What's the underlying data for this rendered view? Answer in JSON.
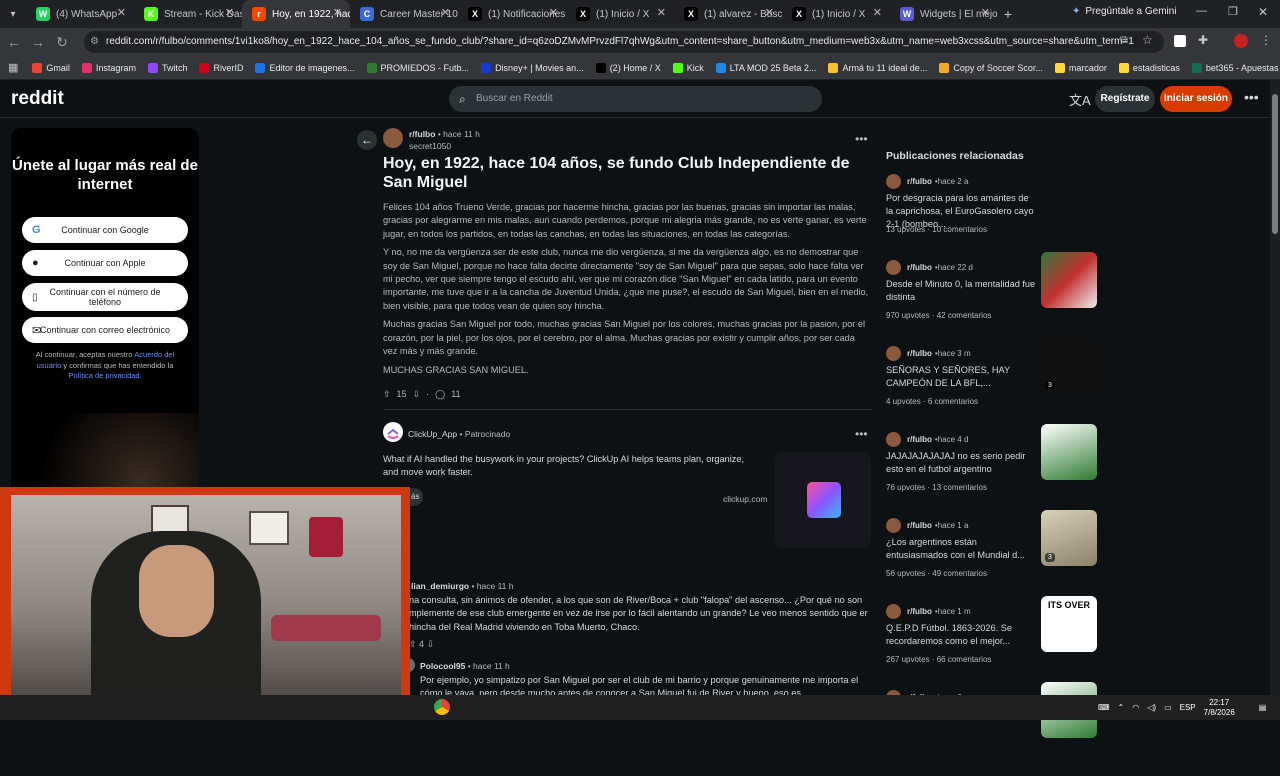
{
  "browser": {
    "tabs": [
      {
        "label": "(4) WhatsApp",
        "color": "#25d366",
        "glyph": "W"
      },
      {
        "label": "Stream - Kick Dash",
        "color": "#53fc18",
        "glyph": "K"
      },
      {
        "label": "Hoy, en 1922, hace",
        "color": "#ff4500",
        "glyph": "r"
      },
      {
        "label": "Career Master 10",
        "color": "#3b6ad6",
        "glyph": "C"
      },
      {
        "label": "(1) Notificaciones",
        "color": "#000000",
        "glyph": "X"
      },
      {
        "label": "(1) Inicio / X",
        "color": "#000000",
        "glyph": "X"
      },
      {
        "label": "(1) alvarez - Buscar",
        "color": "#000000",
        "glyph": "X"
      },
      {
        "label": "(1) Inicio / X",
        "color": "#000000",
        "glyph": "X"
      },
      {
        "label": "Widgets | El mejor",
        "color": "#5b5bd6",
        "glyph": "W"
      }
    ],
    "new_tab": "+",
    "gemini": "Pregúntale a Gemini",
    "url": "reddit.com/r/fulbo/comments/1vi1ko8/hoy_en_1922_hace_104_años_se_fundo_club/?share_id=q6zoDZMvMPrvzdFl7qhWg&utm_content=share_button&utm_medium=web3x&utm_name=web3xcss&utm_source=share&utm_term=1",
    "bookmarks": [
      {
        "label": "Gmail",
        "color": "#ea4335"
      },
      {
        "label": "Instagram",
        "color": "#e1306c"
      },
      {
        "label": "Twitch",
        "color": "#9146ff"
      },
      {
        "label": "RiverID",
        "color": "#d0021b"
      },
      {
        "label": "Editor de imagenes...",
        "color": "#1a73e8"
      },
      {
        "label": "PROMIEDOS - Futb...",
        "color": "#2e7d32"
      },
      {
        "label": "Disney+ | Movies an...",
        "color": "#113ccf"
      },
      {
        "label": "(2) Home / X",
        "color": "#000000"
      },
      {
        "label": "Kick",
        "color": "#53fc18"
      },
      {
        "label": "LTA MOD 25 Beta 2...",
        "color": "#1e88e5"
      },
      {
        "label": "Armá tu 11 ideal de...",
        "color": "#fbc02d"
      },
      {
        "label": "Copy of Soccer Scor...",
        "color": "#f9a825"
      },
      {
        "label": "marcador",
        "color": "#fdd835"
      },
      {
        "label": "estadisticas",
        "color": "#fdd835"
      },
      {
        "label": "bet365 - Apuestas d...",
        "color": "#126e51"
      }
    ]
  },
  "reddit": {
    "logo": "reddit",
    "search_placeholder": "Buscar en Reddit",
    "register": "Regístrate",
    "login": "Iniciar sesión"
  },
  "join": {
    "title": "Únete al lugar más real de internet",
    "google": "Continuar con Google",
    "apple": "Continuar con Apple",
    "phone": "Continuar con el número de teléfono",
    "email": "Continuar con correo electrónico",
    "terms_1": "Al continuar, aceptas nuestro",
    "terms_link1": "Acuerdo del usuario",
    "terms_2": "y confirmas que has entendido la",
    "terms_link2": "Política de privacidad."
  },
  "post": {
    "subreddit": "r/fulbo",
    "time": "hace 11 h",
    "author": "secret1050",
    "title": "Hoy, en 1922, hace 104 años, se fundo Club Independiente de San Miguel",
    "paragraphs": [
      "Felices 104 años Trueno Verde, gracias por hacerme hincha, gracias por las buenas, gracias sin importar las malas, gracias por alegrarme en mis malas, aun cuando perdemos, porque mi alegria más grande, no es verte ganar, es verte jugar, en todos los partidos, en todas las canchas, en todas las situaciones, en todas las categorías.",
      "Y no, no me da vergüenza ser de este club, nunca me dio vergüenza, si me da vergüenza algo, es no demostrar que soy de San Miguel, porque no hace falta decirte directamente \"soy de San Miguel\" para que sepas, solo hace falta ver mi pecho, ver que siempre tengo el escudo ahí, ver que mi corazón dice \"San Miguel\" en cada latido, para un evento importante, me tuve que ir a la cancha de Juventud Unida, ¿que me puse?, el escudo de San Miguel, bien en el medio, bien visible, para que todos vean de quien soy hincha.",
      "Muchas gracias San Miguel por todo, muchas gracias San Miguel por los colores, muchas gracias por la pasion, por el corazón, por la piel, por los ojos, por el cerebro, por el alma. Muchas gracias por existir y cumplir años, por ser cada vez más y más grande.",
      "MUCHAS GRACIAS SAN MIGUEL."
    ],
    "upvotes": "15",
    "comments": "11"
  },
  "ad": {
    "name": "ClickUp_App",
    "sponsored": "Patrocinado",
    "text": "What if AI handled the busywork in your projects? ClickUp AI helps teams plan, organize, and move work faster.",
    "button": "ás",
    "domain": "clickup.com"
  },
  "comments": [
    {
      "author": "lian_demiurgo",
      "time": "hace 11 h",
      "text": "na consulta, sin ánimos de ofender, a los que son de River/Boca + club \"falopa\" del ascenso... ¿Por qué no son mplemente de ese club emergente en vez de irse por lo fácil alentando un grande? Le veo menos sentido que er hincha del Real Madrid viviendo en Toba Muerto, Chaco.",
      "votes": "4"
    },
    {
      "author": "Polocool95",
      "time": "hace 11 h",
      "text": "Por ejemplo, yo simpatizo por San Miguel por ser el club de mi barrio y porque genuinamente me importa el cómo le vaya, pero desde mucho antes de conocer a San Miguel fui de River y bueno, eso es"
    }
  ],
  "related": {
    "title": "Publicaciones relacionadas",
    "items": [
      {
        "sub": "r/fulbo",
        "time": "hace 2 a",
        "text": "Por desgracia para los amantes de la caprichosa, el EuroGasolero cayo 2-1 (bombeo...",
        "upvotes": "13 upvotes",
        "comments": "10 comentarios",
        "thumb": ""
      },
      {
        "sub": "r/fulbo",
        "time": "hace 22 d",
        "text": "Desde el Minuto 0, la mentalidad fue distinta",
        "upvotes": "970 upvotes",
        "comments": "42 comentarios",
        "thumb": "green"
      },
      {
        "sub": "r/fulbo",
        "time": "hace 3 m",
        "text": "SEÑORAS Y SEÑORES, HAY CAMPEÓN DE LA BFL,...",
        "upvotes": "4 upvotes",
        "comments": "6 comentarios",
        "thumb": "dark",
        "badge": "3"
      },
      {
        "sub": "r/fulbo",
        "time": "hace 4 d",
        "text": "JAJAJAJAJAJAJ no es serio pedir esto en el futbol argentino",
        "upvotes": "76 upvotes",
        "comments": "13 comentarios",
        "thumb": "white"
      },
      {
        "sub": "r/fulbo",
        "time": "hace 1 a",
        "text": "¿Los argentinos están entusiasmados con el Mundial d...",
        "upvotes": "56 upvotes",
        "comments": "49 comentarios",
        "thumb": "tan",
        "badge": "3"
      },
      {
        "sub": "r/fulbo",
        "time": "hace 1 m",
        "text": "Q.E.P.D Fútbol. 1863-2026. Se recordaremos como el mejor...",
        "upvotes": "267 upvotes",
        "comments": "66 comentarios",
        "thumb": "meme",
        "caption": "ITS OVER"
      },
      {
        "sub": "r/fulbo",
        "time": "hace 8 m",
        "text": "",
        "upvotes": "",
        "comments": "",
        "thumb": "white"
      }
    ]
  },
  "taskbar": {
    "lang": "ESP",
    "time": "22:17",
    "date": "7/8/2026"
  }
}
